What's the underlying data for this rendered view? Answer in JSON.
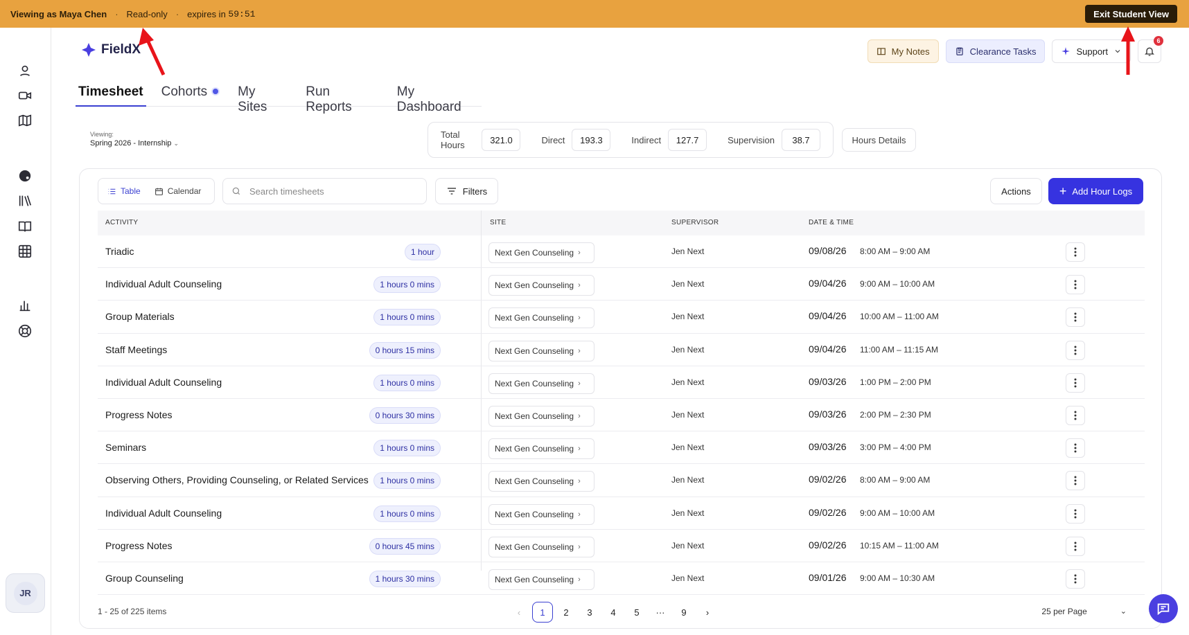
{
  "banner": {
    "viewing_as": "Viewing as Maya Chen",
    "mode": "Read-only",
    "expires_label": "expires in",
    "expires_time": "59:51",
    "exit_label": "Exit Student View",
    "color": "#e8a23f"
  },
  "app": {
    "name": "FieldX",
    "accent": "#3633e0"
  },
  "header": {
    "notes_label": "My Notes",
    "tasks_label": "Clearance Tasks",
    "support_label": "Support",
    "notification_count": "6"
  },
  "tabs": [
    {
      "label": "Timesheet",
      "active": true
    },
    {
      "label": "Cohorts"
    },
    {
      "label": "My Sites"
    },
    {
      "label": "Run Reports"
    },
    {
      "label": "My Dashboard"
    }
  ],
  "viewing": {
    "label": "Viewing:",
    "value": "Spring 2026 - Internship"
  },
  "stats": {
    "total_label": "Total Hours",
    "total": "321.0",
    "direct_label": "Direct",
    "direct": "193.3",
    "indirect_label": "Indirect",
    "indirect": "127.7",
    "supervision_label": "Supervision",
    "supervision": "38.7",
    "details_label": "Hours Details"
  },
  "toolbar": {
    "table_label": "Table",
    "calendar_label": "Calendar",
    "search_placeholder": "Search timesheets",
    "filters_label": "Filters",
    "actions_label": "Actions",
    "add_label": "Add Hour Logs"
  },
  "columns": {
    "activity": "ACTIVITY",
    "site": "SITE",
    "supervisor": "SUPERVISOR",
    "datetime": "DATE & TIME"
  },
  "rows": [
    {
      "activity": "Triadic",
      "duration": "1 hour",
      "site": "Next Gen Counseling",
      "supervisor": "Jen Next",
      "date": "09/08/26",
      "time": "8:00 AM – 9:00 AM"
    },
    {
      "activity": "Individual Adult Counseling",
      "duration": "1 hours 0 mins",
      "site": "Next Gen Counseling",
      "supervisor": "Jen Next",
      "date": "09/04/26",
      "time": "9:00 AM – 10:00 AM"
    },
    {
      "activity": "Group Materials",
      "duration": "1 hours 0 mins",
      "site": "Next Gen Counseling",
      "supervisor": "Jen Next",
      "date": "09/04/26",
      "time": "10:00 AM – 11:00 AM"
    },
    {
      "activity": "Staff Meetings",
      "duration": "0 hours 15 mins",
      "site": "Next Gen Counseling",
      "supervisor": "Jen Next",
      "date": "09/04/26",
      "time": "11:00 AM – 11:15 AM"
    },
    {
      "activity": "Individual Adult Counseling",
      "duration": "1 hours 0 mins",
      "site": "Next Gen Counseling",
      "supervisor": "Jen Next",
      "date": "09/03/26",
      "time": "1:00 PM – 2:00 PM"
    },
    {
      "activity": "Progress Notes",
      "duration": "0 hours 30 mins",
      "site": "Next Gen Counseling",
      "supervisor": "Jen Next",
      "date": "09/03/26",
      "time": "2:00 PM – 2:30 PM"
    },
    {
      "activity": "Seminars",
      "duration": "1 hours 0 mins",
      "site": "Next Gen Counseling",
      "supervisor": "Jen Next",
      "date": "09/03/26",
      "time": "3:00 PM – 4:00 PM"
    },
    {
      "activity": "Observing Others, Providing Counseling, or Related Services",
      "duration": "1 hours 0 mins",
      "site": "Next Gen Counseling",
      "supervisor": "Jen Next",
      "date": "09/02/26",
      "time": "8:00 AM – 9:00 AM"
    },
    {
      "activity": "Individual Adult Counseling",
      "duration": "1 hours 0 mins",
      "site": "Next Gen Counseling",
      "supervisor": "Jen Next",
      "date": "09/02/26",
      "time": "9:00 AM – 10:00 AM"
    },
    {
      "activity": "Progress Notes",
      "duration": "0 hours 45 mins",
      "site": "Next Gen Counseling",
      "supervisor": "Jen Next",
      "date": "09/02/26",
      "time": "10:15 AM – 11:00 AM"
    },
    {
      "activity": "Group Counseling",
      "duration": "1 hours 30 mins",
      "site": "Next Gen Counseling",
      "supervisor": "Jen Next",
      "date": "09/01/26",
      "time": "9:00 AM – 10:30 AM"
    }
  ],
  "pagination": {
    "summary": "1 - 25 of 225 items",
    "pages": [
      "1",
      "2",
      "3",
      "4",
      "5",
      "···",
      "9"
    ],
    "current": "1",
    "per_page": "25 per Page"
  },
  "user": {
    "initials": "JR"
  }
}
